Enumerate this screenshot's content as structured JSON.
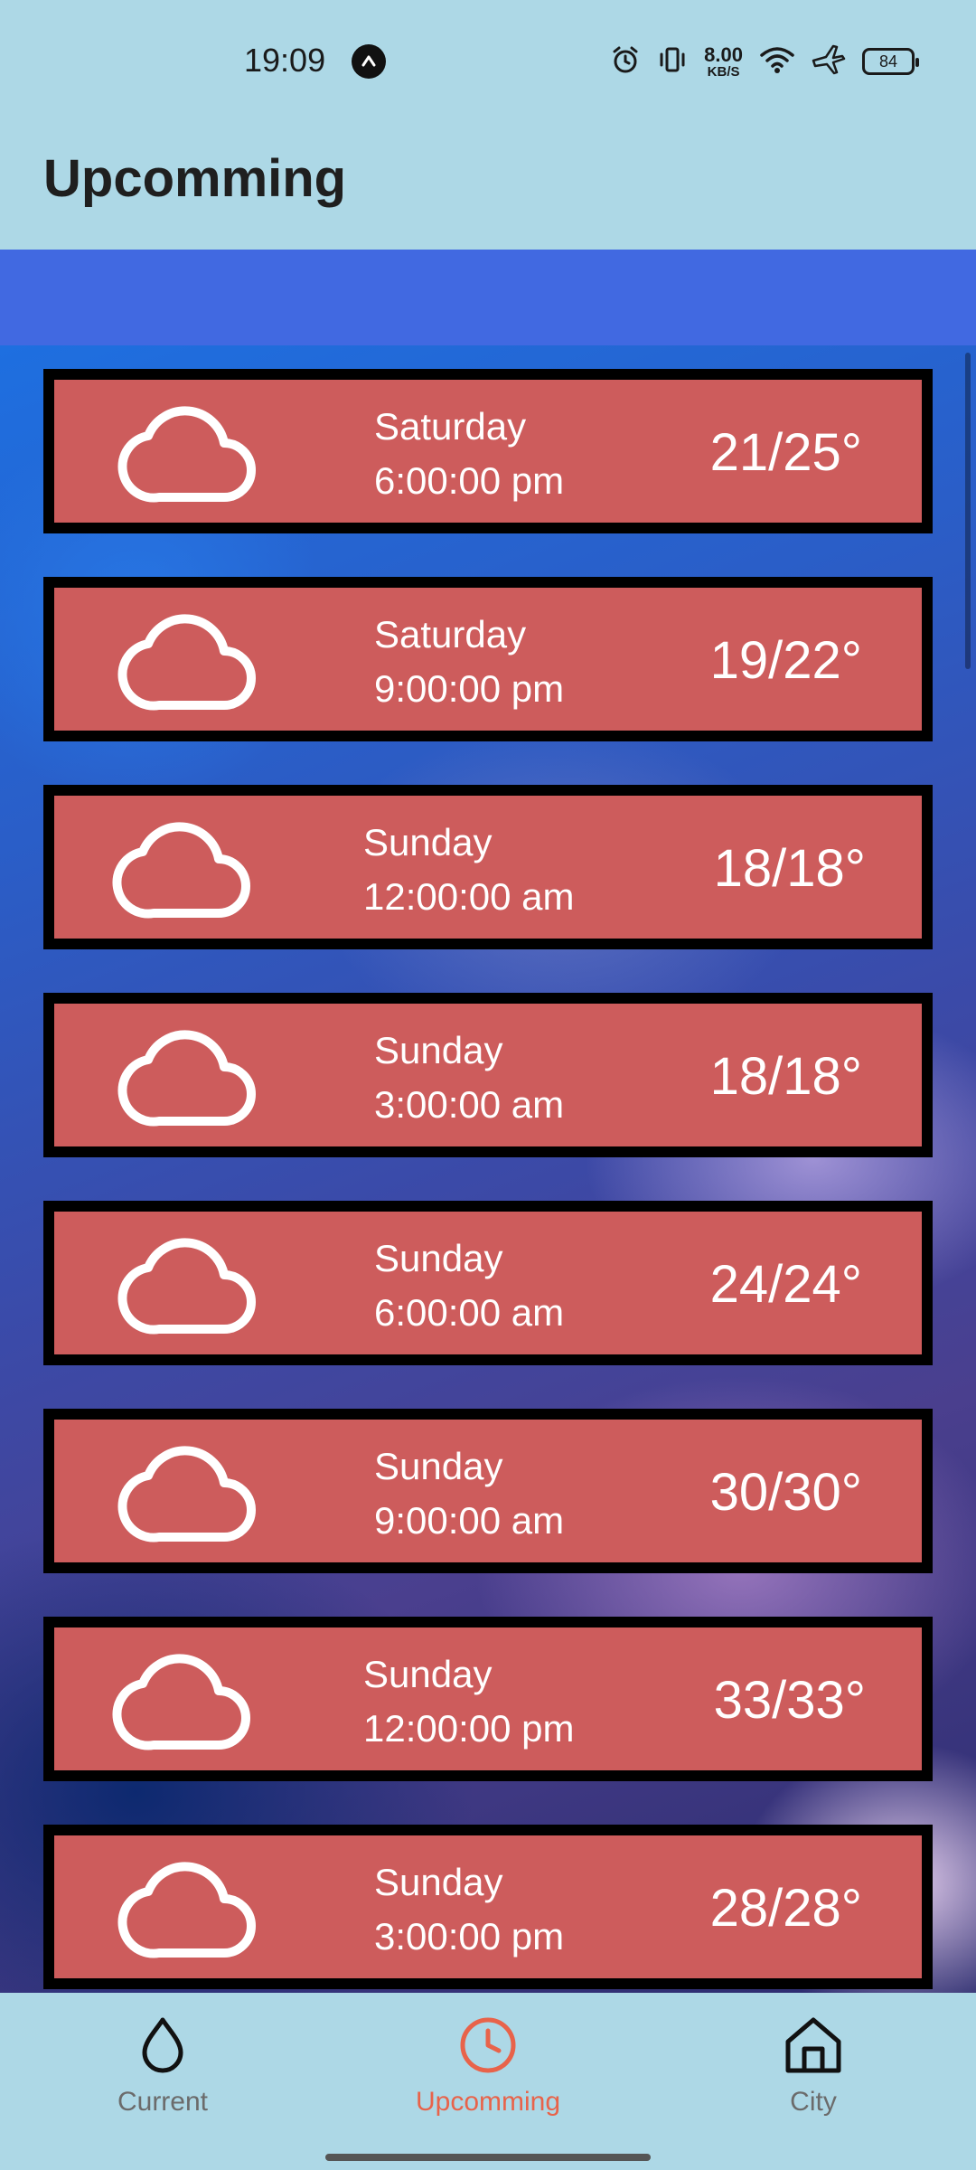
{
  "status_bar": {
    "time": "19:09",
    "net_speed_value": "8.00",
    "net_speed_unit": "KB/S",
    "battery": "84",
    "icons": [
      "app-notification-icon",
      "alarm-icon",
      "vibrate-icon",
      "wifi-icon",
      "airplane-icon",
      "battery-icon"
    ]
  },
  "app_bar": {
    "title": "Upcomming"
  },
  "colors": {
    "app_bar": "#ADD8E6",
    "strip": "#4169E1",
    "card": "#CD5C5C",
    "card_border": "#000000",
    "active_tab": "#E8634A"
  },
  "forecast": [
    {
      "day": "Saturday",
      "time": "6:00:00 pm",
      "temp": "21/25°",
      "icon": "cloud-icon"
    },
    {
      "day": "Saturday",
      "time": "9:00:00 pm",
      "temp": "19/22°",
      "icon": "cloud-icon"
    },
    {
      "day": "Sunday",
      "time": "12:00:00 am",
      "temp": "18/18°",
      "icon": "cloud-icon"
    },
    {
      "day": "Sunday",
      "time": "3:00:00 am",
      "temp": "18/18°",
      "icon": "cloud-icon"
    },
    {
      "day": "Sunday",
      "time": "6:00:00 am",
      "temp": "24/24°",
      "icon": "cloud-icon"
    },
    {
      "day": "Sunday",
      "time": "9:00:00 am",
      "temp": "30/30°",
      "icon": "cloud-icon"
    },
    {
      "day": "Sunday",
      "time": "12:00:00 pm",
      "temp": "33/33°",
      "icon": "cloud-icon"
    },
    {
      "day": "Sunday",
      "time": "3:00:00 pm",
      "temp": "28/28°",
      "icon": "cloud-icon"
    }
  ],
  "bottom_nav": [
    {
      "label": "Current",
      "icon": "drop-icon",
      "active": false
    },
    {
      "label": "Upcomming",
      "icon": "clock-icon",
      "active": true
    },
    {
      "label": "City",
      "icon": "home-icon",
      "active": false
    }
  ]
}
